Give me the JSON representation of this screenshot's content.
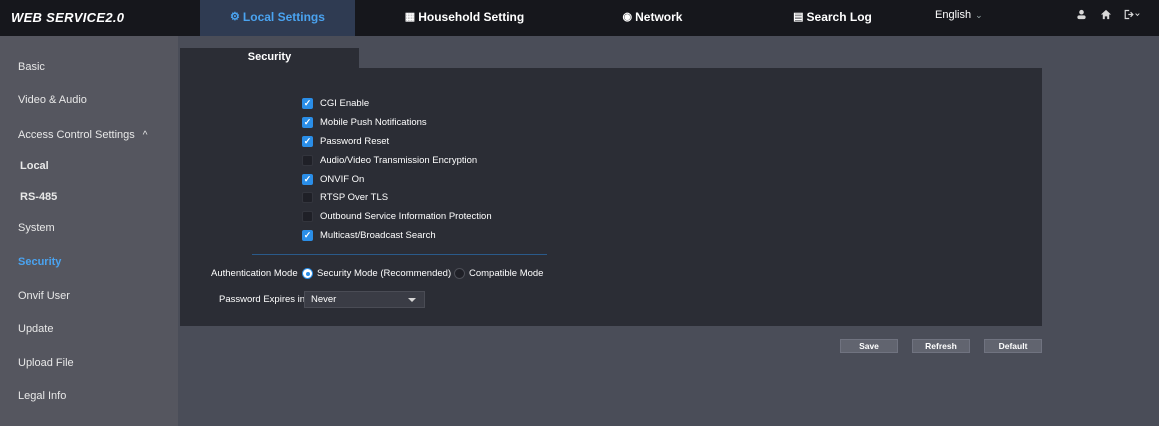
{
  "header": {
    "logo": "WEB SERVICE2.0",
    "nav": [
      {
        "label": "Local Settings",
        "icon": "gear-icon",
        "glyph": "⚙"
      },
      {
        "label": "Household Setting",
        "icon": "building-icon",
        "glyph": "▦"
      },
      {
        "label": "Network",
        "icon": "globe-icon",
        "glyph": "◉"
      },
      {
        "label": "Search Log",
        "icon": "document-icon",
        "glyph": "▤"
      }
    ],
    "language": "English",
    "icons": [
      "user-icon",
      "home-icon",
      "logout-icon"
    ]
  },
  "sidebar": {
    "items": [
      {
        "label": "Basic"
      },
      {
        "label": "Video & Audio"
      },
      {
        "label": "Access Control Settings",
        "expanded": true
      },
      {
        "label": "Local"
      },
      {
        "label": "RS-485"
      },
      {
        "label": "System"
      },
      {
        "label": "Security",
        "active": true
      },
      {
        "label": "Onvif User"
      },
      {
        "label": "Update"
      },
      {
        "label": "Upload File"
      },
      {
        "label": "Legal Info"
      }
    ]
  },
  "main": {
    "tab": "Security",
    "checkboxes": [
      {
        "label": "CGI Enable",
        "checked": true
      },
      {
        "label": "Mobile Push Notifications",
        "checked": true
      },
      {
        "label": "Password Reset",
        "checked": true
      },
      {
        "label": "Audio/Video Transmission Encryption",
        "checked": false
      },
      {
        "label": "ONVIF On",
        "checked": true
      },
      {
        "label": "RTSP Over TLS",
        "checked": false
      },
      {
        "label": "Outbound Service Information Protection",
        "checked": false
      },
      {
        "label": "Multicast/Broadcast Search",
        "checked": true
      }
    ],
    "auth_mode": {
      "label": "Authentication Mode",
      "options": [
        "Security Mode (Recommended)",
        "Compatible Mode"
      ],
      "selected": "Security Mode (Recommended)"
    },
    "password_expires": {
      "label": "Password Expires in",
      "value": "Never"
    },
    "buttons": {
      "save": "Save",
      "refresh": "Refresh",
      "default": "Default"
    }
  },
  "colors": {
    "accent": "#2a8ee8",
    "active_text": "#4aa3f0",
    "topbar": "#16171c",
    "sidebar": "#55565f",
    "panel": "#2b2d35",
    "background": "#4a4d58"
  }
}
